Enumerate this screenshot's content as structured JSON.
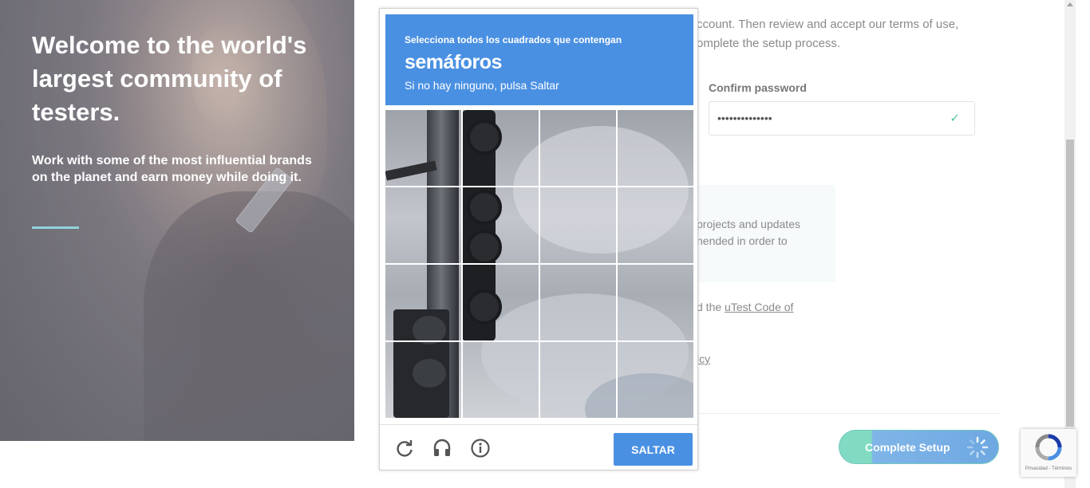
{
  "hero": {
    "title": "Welcome to the world's largest community of testers.",
    "subtitle": "Work with some of the most influential brands on the planet and earn money while doing it."
  },
  "form": {
    "intro_line1": "ccount. Then review and accept our terms of use,",
    "intro_line2": "omplete the setup process.",
    "confirm_password_label": "Confirm password",
    "confirm_password_value": "••••••••••••••",
    "info_text": "projects and updates nended in order to",
    "code_prefix": "d the ",
    "code_link": "uTest Code of",
    "policy_fragment": "icy",
    "complete_setup_label": "Complete Setup"
  },
  "captcha": {
    "instruction": "Selecciona todos los cuadrados que contengan",
    "target": "semáforos",
    "skip_hint": "Si no hay ninguno, pulsa Saltar",
    "grid_rows": 4,
    "grid_cols": 4,
    "skip_button": "SALTAR",
    "icons": [
      "reload-icon",
      "audio-icon",
      "info-icon"
    ]
  },
  "recaptcha_badge": {
    "links": "Privacidad - Términos"
  },
  "colors": {
    "captcha_blue": "#4a90e2",
    "accent_teal": "#80dbc2",
    "hero_rule": "#8fd3dd"
  }
}
